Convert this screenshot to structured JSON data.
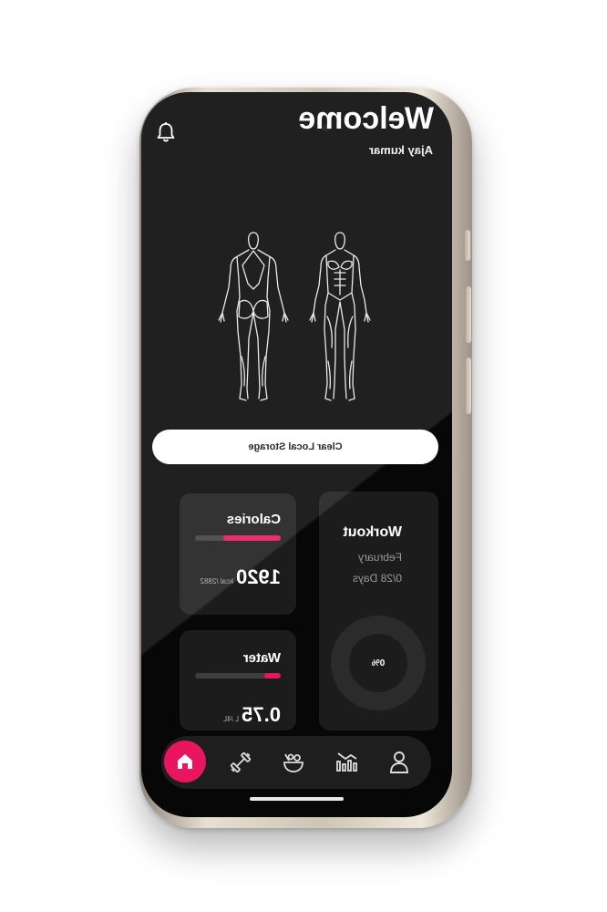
{
  "header": {
    "greeting": "Welcome",
    "username": "Ajay kumar"
  },
  "actions": {
    "clear_storage_label": "Clear Local Storage"
  },
  "calories": {
    "title": "Calories",
    "value": "1920",
    "unit": "kcal /2882",
    "progress": 0.67
  },
  "water": {
    "title": "Water",
    "value": "0.75",
    "unit": "L /4L",
    "progress": 0.19
  },
  "workout": {
    "title": "Workout",
    "month": "February",
    "days": "0/28 Days",
    "percent_label": "0%"
  },
  "nav": {
    "items": [
      "home-icon",
      "dumbbell-icon",
      "food-bowl-icon",
      "stats-icon",
      "profile-icon"
    ],
    "active": "home-icon"
  },
  "colors": {
    "accent": "#e9155e",
    "background": "#070707",
    "card": "#1c1c1c"
  }
}
